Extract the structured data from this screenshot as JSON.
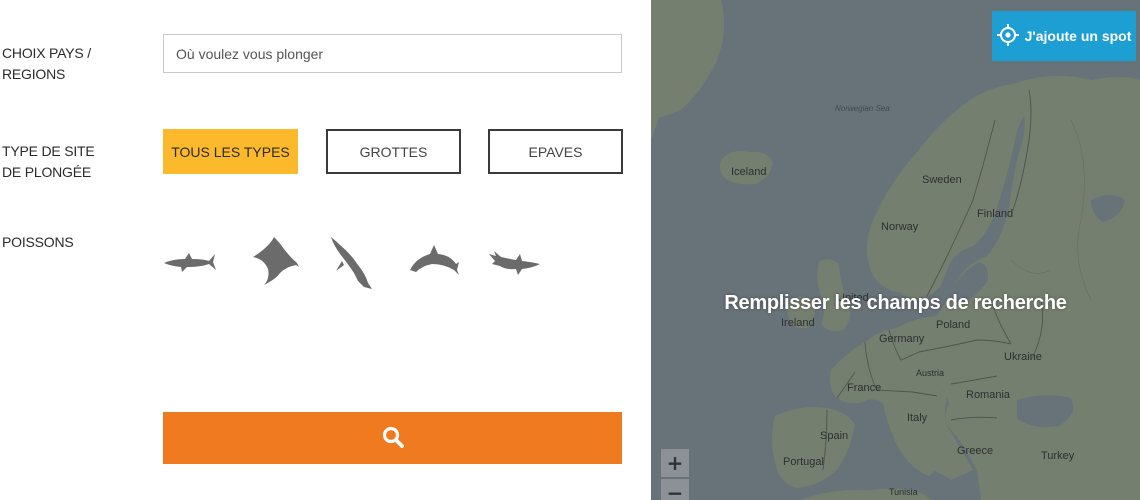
{
  "search_panel": {
    "country_label": "CHOIX PAYS / REGIONS",
    "country_placeholder": "Où voulez vous plonger",
    "type_label": "TYPE DE SITE DE PLONGÉE",
    "type_buttons": [
      "TOUS LES TYPES",
      "GROTTES",
      "EPAVES"
    ],
    "active_type": "TOUS LES TYPES",
    "fish_label": "POISSONS",
    "fish_icons": [
      "shark-icon",
      "manta-ray-icon",
      "whale-icon",
      "dolphin-icon",
      "hammerhead-shark-icon"
    ],
    "search_icon": "search-icon"
  },
  "map": {
    "message": "Remplisser les champs de recherche",
    "add_spot_label": "J'ajoute un spot",
    "add_spot_icon": "target-icon",
    "zoom_in": "+",
    "zoom_out": "−",
    "labels": {
      "norwegian_sea": "Norwegian Sea",
      "iceland": "Iceland",
      "sweden": "Sweden",
      "finland": "Finland",
      "norway": "Norway",
      "united_kingdom": "United",
      "ireland": "Ireland",
      "poland": "Poland",
      "germany": "Germany",
      "ukraine": "Ukraine",
      "austria": "Austria",
      "france": "France",
      "romania": "Romania",
      "italy": "Italy",
      "spain": "Spain",
      "portugal": "Portugal",
      "greece": "Greece",
      "turkey": "Turkey",
      "tunisia": "Tunisia"
    }
  },
  "colors": {
    "active_type": "#fcb92b",
    "search_button": "#ef7a1f",
    "add_spot_button": "#1d9fd3",
    "map_water": "#6f7a83",
    "map_land": "#7f8a77"
  }
}
